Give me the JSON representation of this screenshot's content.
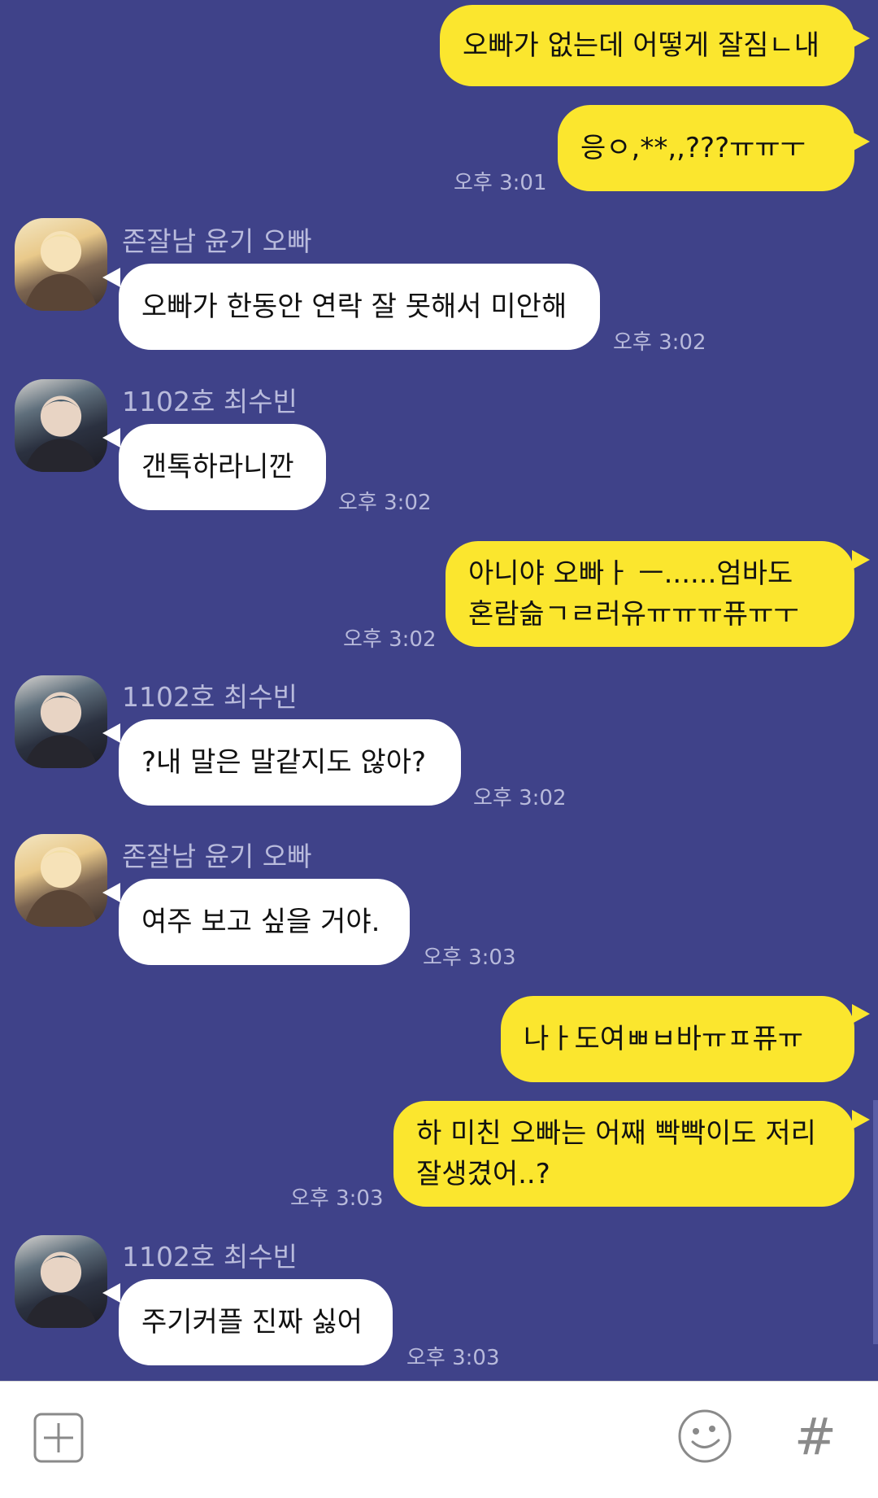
{
  "messages": [
    {
      "from": "me",
      "lines": [
        "오빠가 없는데 어떻게 잘짐ㄴ내"
      ],
      "time": ""
    },
    {
      "from": "me",
      "lines": [
        "응ㅇ,**,,???ㅠㅠㅜ"
      ],
      "time": "오후 3:01"
    },
    {
      "from": "them",
      "sender": "존잘남 윤기 오빠",
      "lines": [
        "오빠가 한동안 연락 잘 못해서 미안해"
      ],
      "time": "오후 3:02"
    },
    {
      "from": "them",
      "sender": "1102호 최수빈",
      "lines": [
        "갠톡하라니깐"
      ],
      "time": "오후 3:02"
    },
    {
      "from": "me",
      "lines": [
        "아니야 오빠ㅏ ㅡ......엄바도",
        "혼람슮ㄱㄹ러유ㅠㅠㅠ퓨ㅠㅜ"
      ],
      "time": "오후 3:02"
    },
    {
      "from": "them",
      "sender": "1102호 최수빈",
      "lines": [
        "?내 말은 말같지도 않아?"
      ],
      "time": "오후 3:02"
    },
    {
      "from": "them",
      "sender": "존잘남 윤기 오빠",
      "lines": [
        "여주 보고 싶을 거야."
      ],
      "time": "오후 3:03"
    },
    {
      "from": "me",
      "lines": [
        "나ㅏ도여ㅃㅂ바ㅠㅍ퓨ㅠ"
      ],
      "time": ""
    },
    {
      "from": "me",
      "lines": [
        "하 미친 오빠는 어째 빡빡이도 저리",
        "잘생겼어..?"
      ],
      "time": "오후 3:03"
    },
    {
      "from": "them",
      "sender": "1102호 최수빈",
      "lines": [
        "주기커플 진짜 싫어"
      ],
      "time": "오후 3:03"
    }
  ],
  "input_bar": {
    "add_icon": "plus-square-icon",
    "emoji_icon": "smiley-icon",
    "hashtag_label": "#"
  },
  "colors": {
    "background": "#3f4289",
    "my_bubble": "#fbe62e",
    "their_bubble": "#ffffff",
    "timestamp": "#b8badb"
  }
}
